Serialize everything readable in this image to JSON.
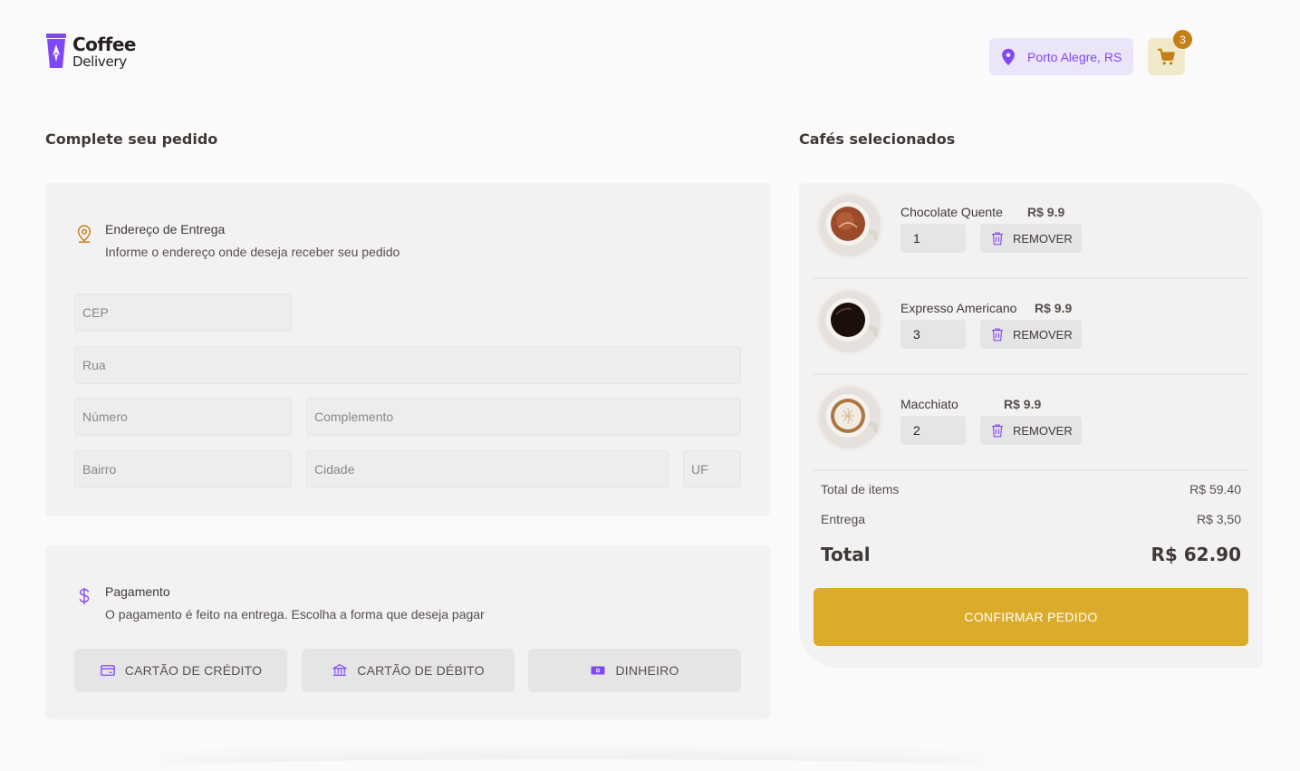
{
  "header": {
    "logo_line1": "Coffee",
    "logo_line2": "Delivery",
    "location": "Porto Alegre, RS",
    "cart_count": "3"
  },
  "checkout": {
    "title": "Complete seu pedido",
    "address": {
      "title": "Endereço de Entrega",
      "subtitle": "Informe o endereço onde deseja receber seu pedido",
      "placeholders": {
        "cep": "CEP",
        "rua": "Rua",
        "numero": "Número",
        "complemento": "Complemento",
        "bairro": "Bairro",
        "cidade": "Cidade",
        "uf": "UF"
      }
    },
    "payment": {
      "title": "Pagamento",
      "subtitle": "O pagamento é feito na entrega. Escolha a forma que deseja pagar",
      "options": [
        "CARTÃO DE CRÉDITO",
        "CARTÃO DE DÉBITO",
        "DINHEIRO"
      ]
    }
  },
  "cart": {
    "title": "Cafés selecionados",
    "items": [
      {
        "name": "Chocolate Quente",
        "price": "R$ 9.9",
        "quantity": "1",
        "remove_label": "REMOVER"
      },
      {
        "name": "Expresso Americano",
        "price": "R$ 9.9",
        "quantity": "3",
        "remove_label": "REMOVER"
      },
      {
        "name": "Macchiato",
        "price": "R$ 9.9",
        "quantity": "2",
        "remove_label": "REMOVER"
      }
    ],
    "summary": {
      "items_label": "Total de items",
      "items_value": "R$ 59.40",
      "delivery_label": "Entrega",
      "delivery_value": "R$ 3,50",
      "total_label": "Total",
      "total_value": "R$ 62.90"
    },
    "confirm_label": "CONFIRMAR PEDIDO"
  },
  "colors": {
    "purple": "#8047f8",
    "purple_light": "#ebe5f9",
    "yellow": "#dbac2c",
    "yellow_dark": "#c47f17",
    "yellow_light": "#f1e9c9"
  }
}
